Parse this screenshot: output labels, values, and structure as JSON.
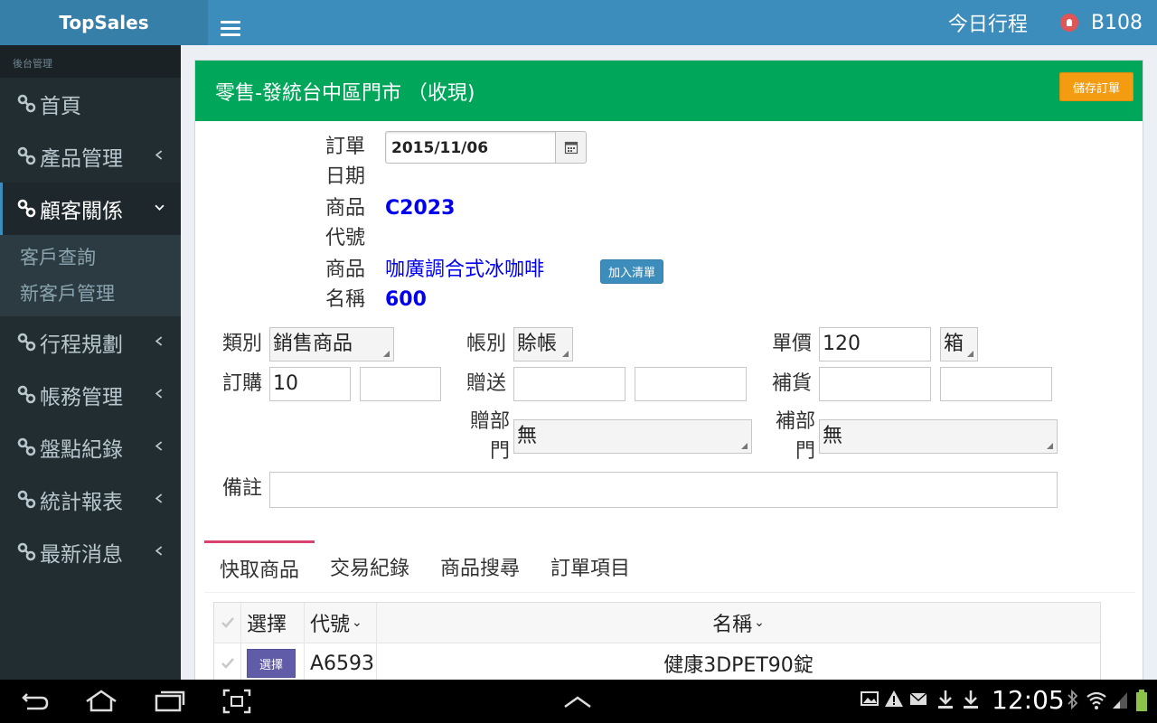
{
  "app": {
    "brand": "TopSales"
  },
  "topbar": {
    "schedule_label": "今日行程",
    "user_code": "B108"
  },
  "sidebar": {
    "header": "後台管理",
    "items": [
      {
        "label": "首頁"
      },
      {
        "label": "產品管理"
      },
      {
        "label": "顧客關係",
        "active": true,
        "sub": [
          {
            "label": "客戶查詢"
          },
          {
            "label": "新客戶管理"
          }
        ]
      },
      {
        "label": "行程規劃"
      },
      {
        "label": "帳務管理"
      },
      {
        "label": "盤點紀錄"
      },
      {
        "label": "統計報表"
      },
      {
        "label": "最新消息"
      }
    ]
  },
  "panel": {
    "title": "零售-發統台中區門市 （收現)",
    "save_button": "儲存訂單"
  },
  "form": {
    "order_date_label_1": "訂單",
    "order_date_label_2": "日期",
    "order_date": "2015/11/06",
    "product_code_label_1": "商品",
    "product_code_label_2": "代號",
    "product_code": "C2023",
    "product_name_label_1": "商品",
    "product_name_label_2": "名稱",
    "product_name": "咖廣調合式冰咖啡",
    "price_value": "600",
    "add_list_button": "加入清單",
    "category_label": "類別",
    "category_value": "銷售商品",
    "account_label": "帳別",
    "account_value": "賒帳",
    "unit_price_label": "單價",
    "unit_price": "120",
    "unit_value": "箱",
    "order_qty_label": "訂購",
    "order_qty": "10",
    "order_qty2": "",
    "gift_label": "贈送",
    "gift1": "",
    "gift2": "",
    "restock_label": "補貨",
    "restock1": "",
    "restock2": "",
    "gift_dept_label_1": "贈部",
    "gift_dept_label_2": "門",
    "gift_dept_value": "無",
    "restock_dept_label_1": "補部",
    "restock_dept_label_2": "門",
    "restock_dept_value": "無",
    "remark_label": "備註",
    "remark_value": ""
  },
  "tabs": [
    {
      "label": "快取商品",
      "active": true
    },
    {
      "label": "交易紀錄"
    },
    {
      "label": "商品搜尋"
    },
    {
      "label": "訂單項目"
    }
  ],
  "table": {
    "headers": {
      "select": "選擇",
      "code": "代號",
      "name": "名稱"
    },
    "rows": [
      {
        "button": "選擇",
        "code": "A6593",
        "name": "健康3DPET90錠"
      }
    ]
  },
  "statusbar": {
    "time": "12:05"
  }
}
